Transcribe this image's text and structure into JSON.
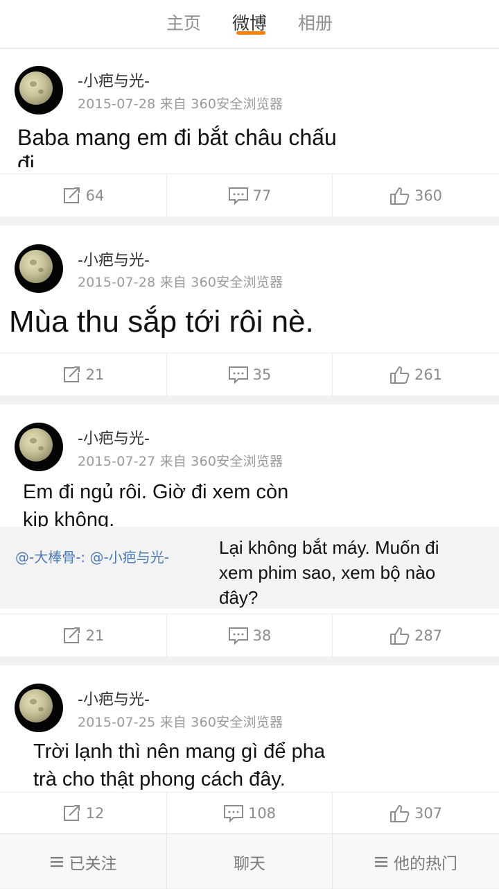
{
  "tabs": [
    {
      "label": "主页"
    },
    {
      "label": "微博",
      "active": true
    },
    {
      "label": "相册"
    }
  ],
  "accent_color": "#ff8200",
  "posts": [
    {
      "user": "-小疤与光-",
      "meta": "2015-07-28 来自 360安全浏览器",
      "text_lines": [
        "Baba mang em đi bắt châu chấu",
        "đi."
      ],
      "repost": "64",
      "comment": "77",
      "like": "360"
    },
    {
      "user": "-小疤与光-",
      "meta": "2015-07-28 来自 360安全浏览器",
      "text_lines": [
        "Mùa thu sắp tới rôi nè."
      ],
      "repost": "21",
      "comment": "35",
      "like": "261"
    },
    {
      "user": "-小疤与光-",
      "meta": "2015-07-27 来自 360安全浏览器",
      "text_lines": [
        "Em đi ngủ rôi. Giờ đi xem còn",
        "kịp không."
      ],
      "repost_mention": "@-大棒骨-: @-小疤与光-",
      "repost_text_lines": [
        "Lại không bắt máy. Muốn đi",
        "xem phim sao, xem bộ nào",
        "đây?"
      ],
      "repost": "21",
      "comment": "38",
      "like": "287"
    },
    {
      "user": "-小疤与光-",
      "meta": "2015-07-25 来自 360安全浏览器",
      "text_lines": [
        "Trời lạnh thì nên mang gì để pha",
        "trà cho thật phong cách đây."
      ],
      "repost": "12",
      "comment": "108",
      "like": "307"
    }
  ],
  "bottom_bar": [
    {
      "label": "已关注",
      "icon": "menu-icon"
    },
    {
      "label": "聊天"
    },
    {
      "label": "他的热门",
      "icon": "menu-icon"
    }
  ]
}
